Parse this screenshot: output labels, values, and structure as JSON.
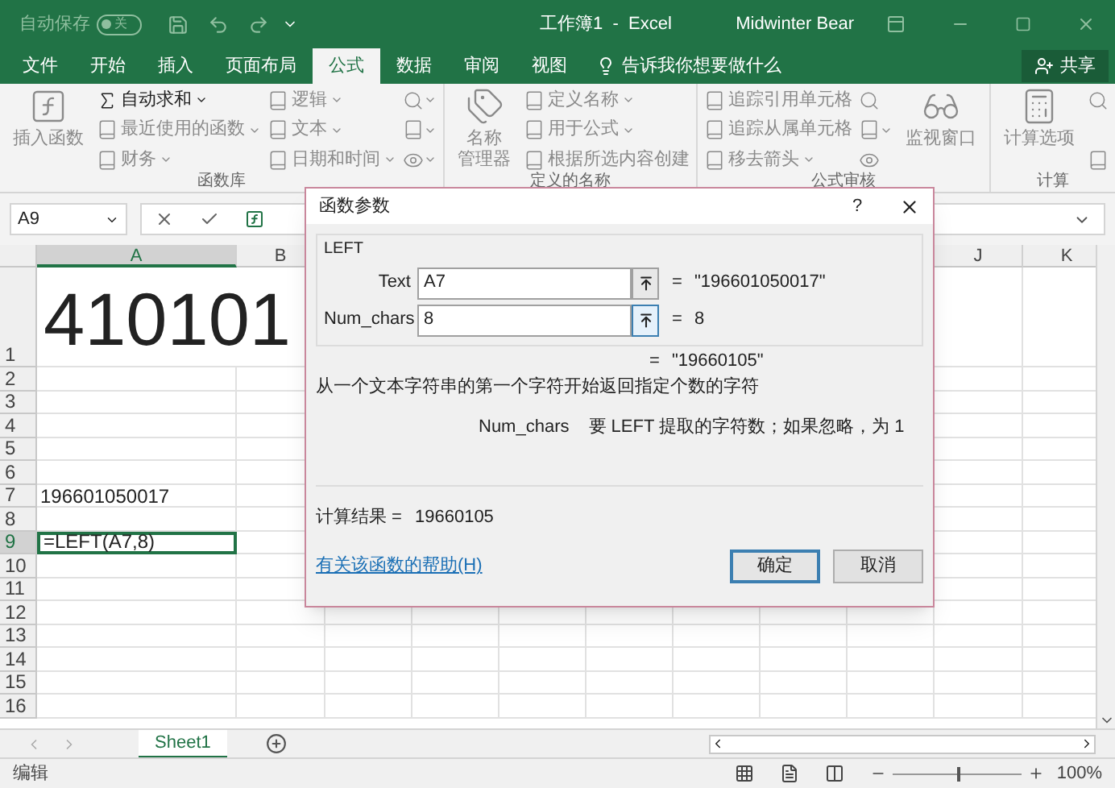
{
  "title_bar": {
    "autosave_label": "自动保存",
    "autosave": {
      "on": false,
      "label": "关"
    },
    "title": "工作簿1  -  Excel",
    "user": "Midwinter Bear"
  },
  "tabs": [
    {
      "label": "文件",
      "selected": false
    },
    {
      "label": "开始",
      "selected": false
    },
    {
      "label": "插入",
      "selected": false
    },
    {
      "label": "页面布局",
      "selected": false
    },
    {
      "label": "公式",
      "selected": true
    },
    {
      "label": "数据",
      "selected": false
    },
    {
      "label": "审阅",
      "selected": false
    },
    {
      "label": "视图",
      "selected": false
    }
  ],
  "tell_me": "告诉我你想要做什么",
  "share": "共享",
  "ribbon": [
    {
      "label": "函数库",
      "items": [
        {
          "kind": "large",
          "label": "插入函数",
          "disabled": true
        },
        {
          "kind": "small",
          "label": "自动求和",
          "dropdown": true,
          "disabled": false
        },
        {
          "kind": "small",
          "label": "最近使用的函数",
          "dropdown": true,
          "disabled": true
        },
        {
          "kind": "small",
          "label": "财务",
          "dropdown": true,
          "disabled": true
        },
        {
          "kind": "small",
          "label": "逻辑",
          "dropdown": true,
          "disabled": true
        },
        {
          "kind": "small",
          "label": "文本",
          "dropdown": true,
          "disabled": true
        },
        {
          "kind": "small",
          "label": "日期和时间",
          "dropdown": true,
          "disabled": true
        },
        {
          "kind": "icon",
          "dropdown": true,
          "disabled": true
        },
        {
          "kind": "icon",
          "dropdown": true,
          "disabled": true
        },
        {
          "kind": "icon",
          "dropdown": true,
          "disabled": true
        }
      ]
    },
    {
      "label": "定义的名称",
      "items": [
        {
          "kind": "large",
          "lines": [
            "名称",
            "管理器"
          ],
          "disabled": true
        },
        {
          "kind": "small",
          "label": "定义名称",
          "dropdown": true,
          "disabled": true
        },
        {
          "kind": "small",
          "label": "用于公式",
          "dropdown": true,
          "disabled": true
        },
        {
          "kind": "small",
          "label": "根据所选内容创建",
          "dropdown": false,
          "disabled": true
        }
      ]
    },
    {
      "label": "公式审核",
      "items": [
        {
          "kind": "small",
          "label": "追踪引用单元格",
          "dropdown": false,
          "disabled": true
        },
        {
          "kind": "small",
          "label": "追踪从属单元格",
          "dropdown": false,
          "disabled": true
        },
        {
          "kind": "small",
          "label": "移去箭头",
          "dropdown": true,
          "disabled": true
        },
        {
          "kind": "icon",
          "dropdown": false,
          "disabled": true
        },
        {
          "kind": "icon",
          "dropdown": true,
          "disabled": true
        },
        {
          "kind": "icon",
          "dropdown": false,
          "disabled": true
        },
        {
          "kind": "large",
          "label": "监视窗口",
          "disabled": true
        }
      ]
    },
    {
      "label": "计算",
      "items": [
        {
          "kind": "large",
          "label": "计算选项",
          "disabled": true
        },
        {
          "kind": "icon",
          "dropdown": false,
          "disabled": true
        },
        {
          "kind": "icon",
          "dropdown": false,
          "disabled": true
        }
      ]
    }
  ],
  "formula_bar": {
    "name_box": "A9"
  },
  "columns": [
    {
      "label": "A",
      "selected": true
    },
    {
      "label": "B",
      "selected": false
    },
    {
      "label": "J",
      "selected": false
    },
    {
      "label": "K",
      "selected": false
    }
  ],
  "rows": [
    {
      "label": "1",
      "cell": "410101",
      "selected": false
    },
    {
      "label": "2",
      "selected": false
    },
    {
      "label": "3",
      "selected": false
    },
    {
      "label": "4",
      "selected": false
    },
    {
      "label": "5",
      "selected": false
    },
    {
      "label": "6",
      "selected": false
    },
    {
      "label": "7",
      "cell": "196601050017",
      "selected": false
    },
    {
      "label": "8",
      "selected": false
    },
    {
      "label": "9",
      "cell": "=LEFT(A7,8)",
      "selected": true
    },
    {
      "label": "10",
      "selected": false
    },
    {
      "label": "11",
      "selected": false
    },
    {
      "label": "12",
      "selected": false
    },
    {
      "label": "13",
      "selected": false
    },
    {
      "label": "14",
      "selected": false
    },
    {
      "label": "15",
      "selected": false
    },
    {
      "label": "16",
      "selected": false
    }
  ],
  "dialog": {
    "title": "函数参数",
    "help": "?",
    "function": "LEFT",
    "args": [
      {
        "label": "Text",
        "value": "A7",
        "equals": "=",
        "result": "\"196601050017\"",
        "focused": false
      },
      {
        "label": "Num_chars",
        "value": "8",
        "equals": "=",
        "result": "8",
        "focused": true
      }
    ],
    "result_equals": "=",
    "result": "\"19660105\"",
    "description": "从一个文本字符串的第一个字符开始返回指定个数的字符",
    "arg_name": "Num_chars",
    "arg_help": "要 LEFT 提取的字符数；如果忽略，为 1",
    "calc_label": "计算结果 =",
    "calc_value": "19660105",
    "help_link": "有关该函数的帮助(H)",
    "buttons": [
      {
        "label": "确定",
        "default": true
      },
      {
        "label": "取消",
        "default": false
      }
    ]
  },
  "sheets": [
    {
      "label": "Sheet1",
      "selected": true
    }
  ],
  "status": {
    "mode": "编辑",
    "zoom": "100%",
    "level": 0.5
  }
}
